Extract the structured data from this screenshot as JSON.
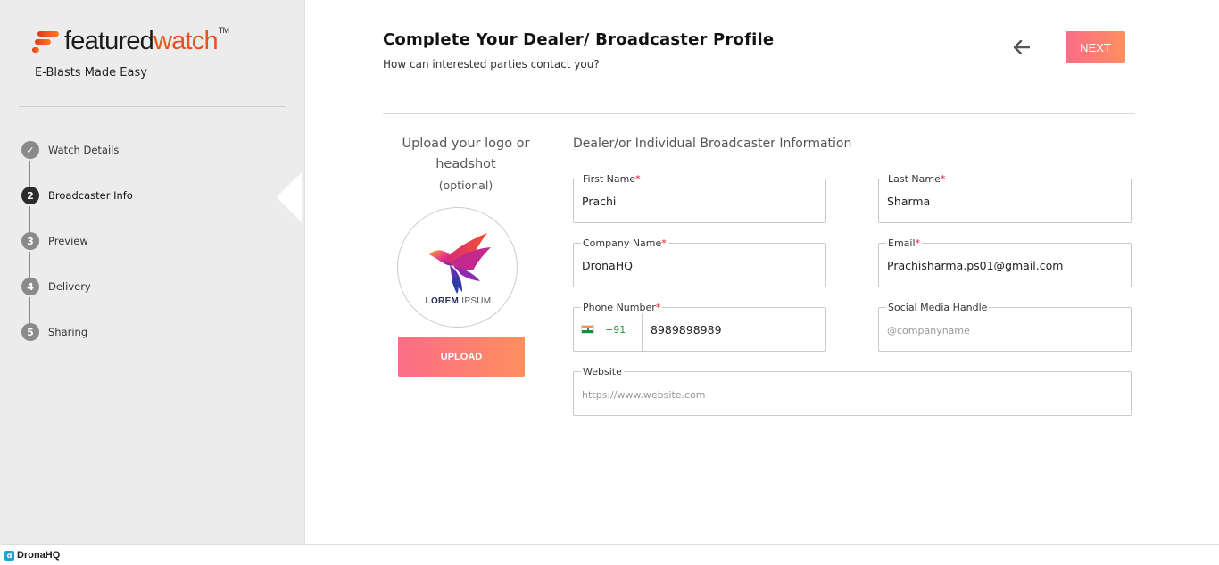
{
  "brand": {
    "logo_text_dark": "featured",
    "logo_text_accent": "watch",
    "logo_tm": "TM",
    "tagline": "E-Blasts Made Easy",
    "accent_color": "#e8521c"
  },
  "steps": [
    {
      "number": "✓",
      "label": "Watch Details",
      "state": "completed"
    },
    {
      "number": "2",
      "label": "Broadcaster Info",
      "state": "active"
    },
    {
      "number": "3",
      "label": "Preview",
      "state": "pending"
    },
    {
      "number": "4",
      "label": "Delivery",
      "state": "pending"
    },
    {
      "number": "5",
      "label": "Sharing",
      "state": "pending"
    }
  ],
  "header": {
    "title": "Complete Your Dealer/ Broadcaster Profile",
    "subtitle": "How can interested parties contact you?",
    "back_icon": "arrow-left-icon",
    "next_label": "NEXT"
  },
  "upload": {
    "title": "Upload your logo or headshot",
    "optional": "(optional)",
    "logo_text_bold": "LOREM",
    "logo_text_light": "IPSUM",
    "button_label": "UPLOAD"
  },
  "form": {
    "section_title": "Dealer/or Individual Broadcaster Information",
    "first_name": {
      "label": "First Name",
      "required": "*",
      "value": "Prachi"
    },
    "last_name": {
      "label": "Last Name",
      "required": "*",
      "value": "Sharma"
    },
    "company_name": {
      "label": "Company Name",
      "required": "*",
      "value": "DronaHQ"
    },
    "email": {
      "label": "Email",
      "required": "*",
      "value": "Prachisharma.ps01@gmail.com"
    },
    "phone": {
      "label": "Phone Number",
      "required": "*",
      "dial_code": "+91",
      "value": "8989898989"
    },
    "social": {
      "label": "Social Media Handle",
      "placeholder": "@companyname"
    },
    "website": {
      "label": "Website",
      "placeholder": "https://www.website.com"
    }
  },
  "footer": {
    "icon_letter": "d",
    "text": "DronaHQ"
  }
}
